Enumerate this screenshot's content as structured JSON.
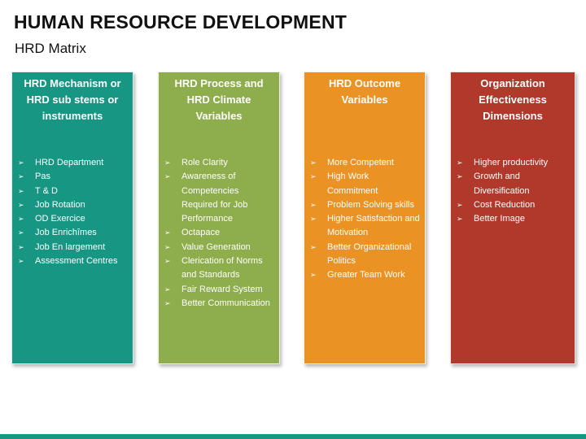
{
  "slide": {
    "title": "HUMAN RESOURCE DEVELOPMENT",
    "subtitle": "HRD Matrix"
  },
  "colors": {
    "teal": "#169683",
    "green": "#8EAD4C",
    "orange": "#EA9324",
    "red": "#B0392C",
    "footer": "#169683"
  },
  "bullet_icon": "arrow-bullet-icon",
  "columns": [
    {
      "heading": "HRD Mechanism or HRD sub stems or instruments",
      "color": "#169683",
      "items": [
        "HRD Department",
        "Pas",
        "T & D",
        "Job Rotation",
        "OD Exercice",
        "Job Enrichîmes",
        "Job En largement",
        "Assessment Centres"
      ]
    },
    {
      "heading": "HRD Process and HRD Climate Variables",
      "color": "#8EAD4C",
      "items": [
        "Role Clarity",
        "Awareness of Competencies Required for Job Performance",
        "Octapace",
        "Value Generation",
        "Clerication of Norms and Standards",
        "Fair Reward System",
        "Better Communication"
      ]
    },
    {
      "heading": "HRD Outcome Variables",
      "color": "#EA9324",
      "items": [
        "More Competent",
        "High Work Commitment",
        "Problem Solving skills",
        "Higher Satisfaction and Motivation",
        "Better Organizational Politics",
        "Greater Team Work"
      ]
    },
    {
      "heading": "Organization Effectiveness Dimensions",
      "color": "#B0392C",
      "items": [
        "Higher productivity",
        "Growth and Diversification",
        "Cost Reduction",
        "Better Image"
      ]
    }
  ]
}
